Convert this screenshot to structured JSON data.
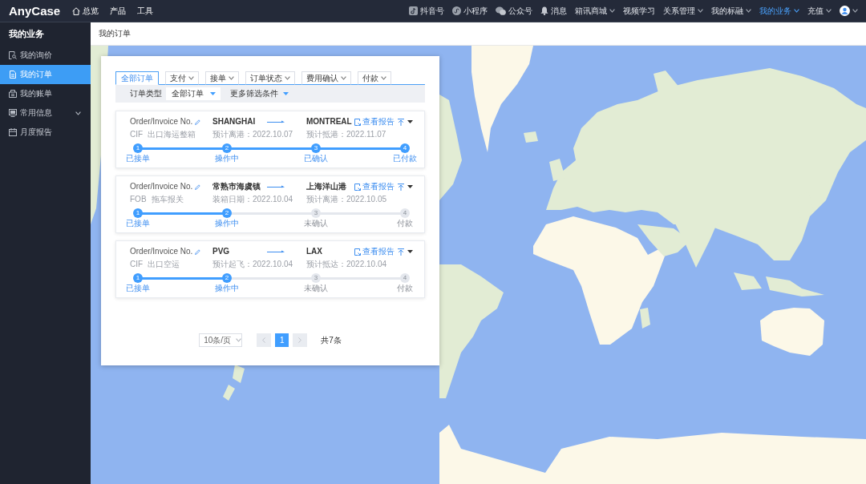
{
  "top_bar": {
    "logo": "AnyCase",
    "nav": [
      {
        "label": "总览",
        "kind": "icon"
      },
      {
        "label": "产品",
        "kind": "text"
      },
      {
        "label": "工具",
        "kind": "text"
      }
    ],
    "quick_links": [
      {
        "label": "抖音号"
      },
      {
        "label": "小程序"
      },
      {
        "label": "公众号"
      },
      {
        "label": "消息"
      }
    ],
    "menus": [
      {
        "label": "箱讯商城",
        "dropdown": true,
        "selected": false
      },
      {
        "label": "视频学习",
        "dropdown": false,
        "selected": false
      },
      {
        "label": "关系管理",
        "dropdown": true,
        "selected": false
      },
      {
        "label": "我的标融",
        "dropdown": true,
        "selected": false
      },
      {
        "label": "我的业务",
        "dropdown": true,
        "selected": true
      },
      {
        "label": "充值",
        "dropdown": true,
        "selected": false
      }
    ],
    "account": {
      "dropdown": true
    }
  },
  "sidebar": {
    "title": "我的业务",
    "items": [
      {
        "label": "我的询价",
        "selected": false,
        "submenu": false
      },
      {
        "label": "我的订单",
        "selected": true,
        "submenu": false
      },
      {
        "label": "我的账单",
        "selected": false,
        "submenu": false
      },
      {
        "label": "常用信息",
        "selected": false,
        "submenu": true
      },
      {
        "label": "月度报告",
        "selected": false,
        "submenu": false
      }
    ]
  },
  "page_title": "我的订单",
  "tabs": [
    {
      "label": "全部订单",
      "dropdown": false,
      "selected": true
    },
    {
      "label": "支付",
      "dropdown": true,
      "selected": false
    },
    {
      "label": "接单",
      "dropdown": true,
      "selected": false
    },
    {
      "label": "订单状态",
      "dropdown": true,
      "selected": false
    },
    {
      "label": "费用确认",
      "dropdown": true,
      "selected": false
    },
    {
      "label": "付款",
      "dropdown": true,
      "selected": false
    }
  ],
  "filter_bar": {
    "order_type_label": "订单类型",
    "order_type_value": "全部订单",
    "more_filters": "更多筛选条件"
  },
  "orders": [
    {
      "order_no": "Order/Invoice No.",
      "origin": "SHANGHAI",
      "destination": "MONTREAL",
      "terms": "CIF",
      "service": "出口海运整箱",
      "date_1": "预计离港：2022.10.07",
      "date_2": "预计抵港：2022.11.07",
      "report": "查看报告",
      "level": 1,
      "steps": [
        {
          "number": "1",
          "label": "已接单",
          "done": true
        },
        {
          "number": "2",
          "label": "操作中",
          "done": true
        },
        {
          "number": "3",
          "label": "已确认",
          "done": true
        },
        {
          "number": "4",
          "label": "已付款",
          "done": true
        }
      ]
    },
    {
      "order_no": "Order/Invoice No.",
      "origin": "常熟市海虞镇",
      "destination": "上海洋山港",
      "terms": "FOB",
      "service": "拖车报关",
      "date_1": "装箱日期：2022.10.04",
      "date_2": "预计离港：2022.10.05",
      "report": "查看报告",
      "level": 0.333,
      "steps": [
        {
          "number": "1",
          "label": "已接单",
          "done": true
        },
        {
          "number": "2",
          "label": "操作中",
          "done": true
        },
        {
          "number": "3",
          "label": "未确认",
          "done": false
        },
        {
          "number": "4",
          "label": "付款",
          "done": false
        }
      ]
    },
    {
      "order_no": "Order/Invoice No.",
      "origin": "PVG",
      "destination": "LAX",
      "terms": "CIF",
      "service": "出口空运",
      "date_1": "预计起飞：2022.10.04",
      "date_2": "预计抵达：2022.10.04",
      "report": "查看报告",
      "level": 0.333,
      "steps": [
        {
          "number": "1",
          "label": "已接单",
          "done": true
        },
        {
          "number": "2",
          "label": "操作中",
          "done": true
        },
        {
          "number": "3",
          "label": "未确认",
          "done": false
        },
        {
          "number": "4",
          "label": "付款",
          "done": false
        }
      ]
    }
  ],
  "pagination": {
    "page_size": "10条/页",
    "prev": {
      "disabled": true
    },
    "pages": [
      {
        "label": "1",
        "selected": true
      }
    ],
    "next": {
      "disabled": true
    },
    "total": "共7条"
  }
}
